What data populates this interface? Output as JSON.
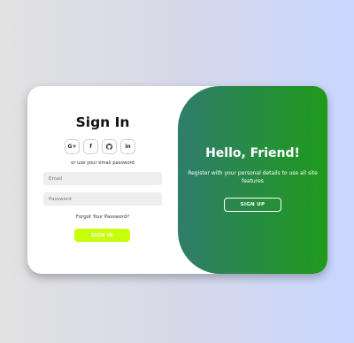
{
  "signin": {
    "title": "Sign In",
    "social": [
      {
        "label": "G+",
        "icon": "google-plus-icon"
      },
      {
        "label": "f",
        "icon": "facebook-icon"
      },
      {
        "label": "",
        "icon": "github-icon"
      },
      {
        "label": "in",
        "icon": "linkedin-icon"
      }
    ],
    "alt_text": "or use your email password",
    "email_placeholder": "Email",
    "password_placeholder": "Password",
    "forgot_label": "Forgot Your Password?",
    "button_label": "SIGN IN"
  },
  "toggle": {
    "title": "Hello, Friend!",
    "text": "Register with your personal details to use all site features",
    "button_label": "SIGN UP"
  },
  "colors": {
    "accent_button": "#c8ff0a",
    "panel_gradient_start": "#2f7d6b",
    "panel_gradient_end": "#1f9a1c"
  }
}
